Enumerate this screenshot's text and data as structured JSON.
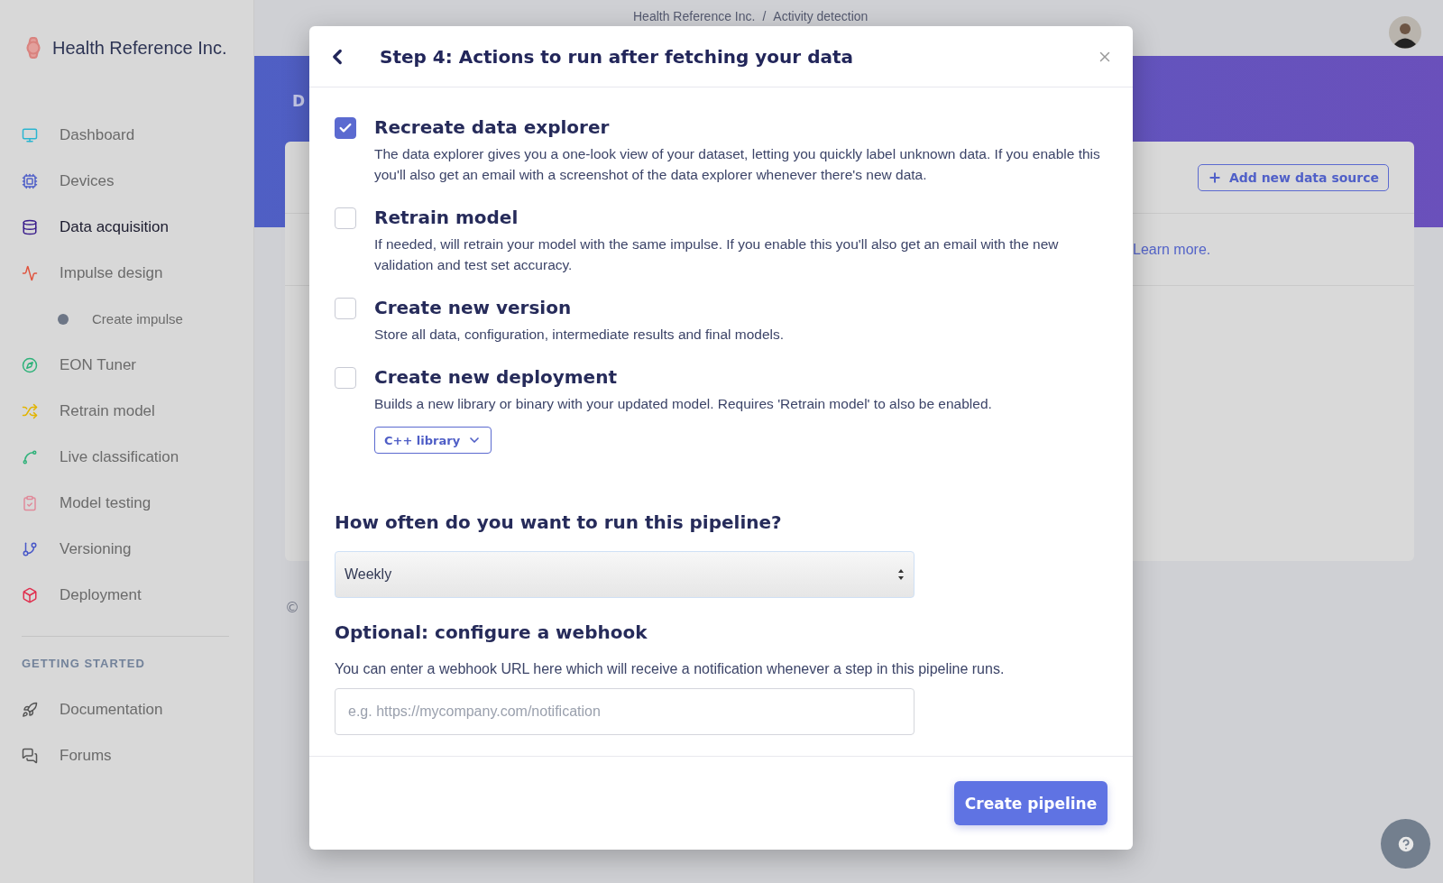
{
  "sidebar": {
    "brand": "Health Reference Inc.",
    "items": [
      {
        "label": "Dashboard",
        "kind": "main",
        "selected": false
      },
      {
        "label": "Devices",
        "kind": "main",
        "selected": false
      },
      {
        "label": "Data acquisition",
        "kind": "main",
        "selected": true
      },
      {
        "label": "Impulse design",
        "kind": "main",
        "selected": false
      },
      {
        "label": "Create impulse",
        "kind": "sub",
        "selected": false
      },
      {
        "label": "EON Tuner",
        "kind": "main",
        "selected": false
      },
      {
        "label": "Retrain model",
        "kind": "main",
        "selected": false
      },
      {
        "label": "Live classification",
        "kind": "main",
        "selected": false
      },
      {
        "label": "Model testing",
        "kind": "main",
        "selected": false
      },
      {
        "label": "Versioning",
        "kind": "main",
        "selected": false
      },
      {
        "label": "Deployment",
        "kind": "main",
        "selected": false
      }
    ],
    "section": {
      "heading": "GETTING STARTED",
      "items": [
        {
          "label": "Documentation"
        },
        {
          "label": "Forums"
        }
      ]
    }
  },
  "header": {
    "breadcrumb": [
      "Health Reference Inc.",
      "/",
      "Activity detection"
    ]
  },
  "page": {
    "title": "D",
    "add_button": "Add new data source",
    "link": "Learn more.",
    "footer": "©"
  },
  "modal": {
    "title": "Step 4: Actions to run after fetching your data",
    "actions": [
      {
        "title": "Recreate data explorer",
        "description": "The data explorer gives you a one-look view of your dataset, letting you quickly label unknown data. If you enable this you'll also get an email with a screenshot of the data explorer whenever there's new data.",
        "checked": true
      },
      {
        "title": "Retrain model",
        "description": "If needed, will retrain your model with the same impulse. If you enable this you'll also get an email with the new validation and test set accuracy.",
        "checked": false
      },
      {
        "title": "Create new version",
        "description": "Store all data, configuration, intermediate results and final models.",
        "checked": false
      },
      {
        "title": "Create new deployment",
        "description": "Builds a new library or binary with your updated model. Requires 'Retrain model' to also be enabled.",
        "checked": false,
        "dropdown": "C++ library"
      }
    ],
    "frequency": {
      "heading": "How often do you want to run this pipeline?",
      "value": "Weekly"
    },
    "webhook": {
      "heading": "Optional: configure a webhook",
      "description": "You can enter a webhook URL here which will receive a notification whenever a step in this pipeline runs.",
      "placeholder": "e.g. https://mycompany.com/notification"
    },
    "submit": "Create pipeline"
  }
}
